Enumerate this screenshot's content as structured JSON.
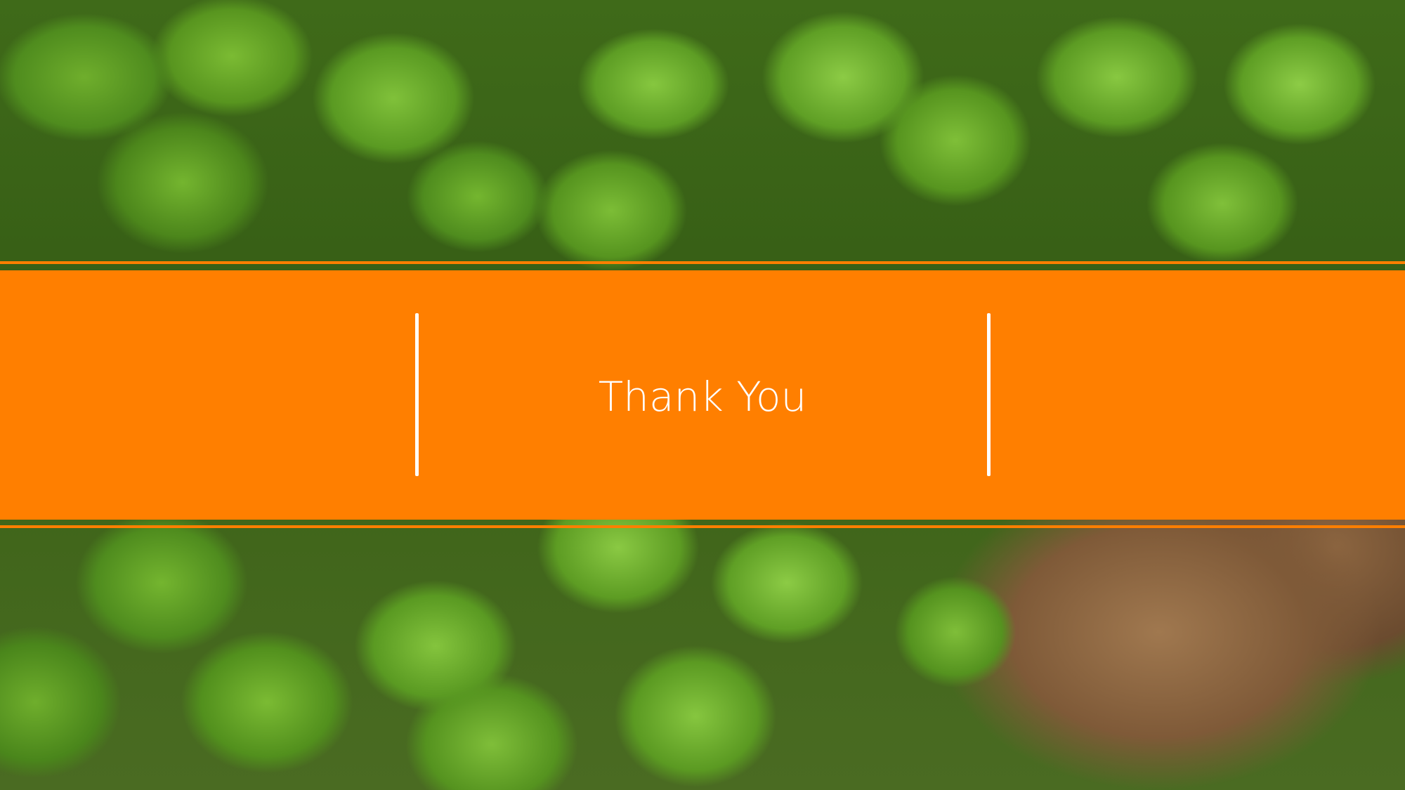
{
  "slide": {
    "title": "Thank You"
  },
  "colors": {
    "accent": "#ff7f00",
    "divider": "#ffffff",
    "title_text": "#ffffff"
  },
  "background": {
    "icon": "leafy-groundcover-photo"
  }
}
